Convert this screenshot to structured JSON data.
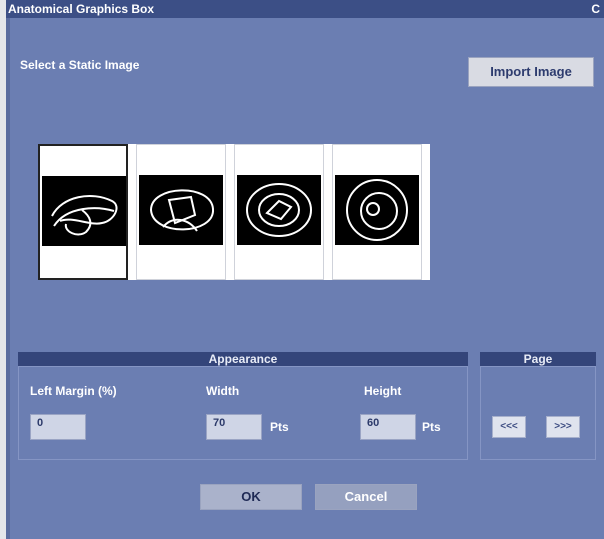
{
  "window": {
    "title": "Anatomical Graphics Box",
    "close_glyph": "C"
  },
  "main": {
    "select_label": "Select a Static Image",
    "import_button": "Import Image"
  },
  "gallery": {
    "thumbnails": [
      {
        "name": "thumbnail-1",
        "selected": true
      },
      {
        "name": "thumbnail-2",
        "selected": false
      },
      {
        "name": "thumbnail-3",
        "selected": false
      },
      {
        "name": "thumbnail-4",
        "selected": false
      }
    ]
  },
  "appearance": {
    "header": "Appearance",
    "left_margin": {
      "label": "Left Margin (%)",
      "value": "0"
    },
    "width": {
      "label": "Width",
      "value": "70",
      "unit": "Pts"
    },
    "height": {
      "label": "Height",
      "value": "60",
      "unit": "Pts"
    }
  },
  "page": {
    "header": "Page",
    "prev_label": "<<<",
    "next_label": ">>>"
  },
  "footer": {
    "ok_label": "OK",
    "cancel_label": "Cancel"
  },
  "colors": {
    "dialog_bg": "#6b7eb2",
    "titlebar_bg": "#3c4f86",
    "section_header_bg": "#34457a",
    "button_bg": "#d9dbe3"
  }
}
